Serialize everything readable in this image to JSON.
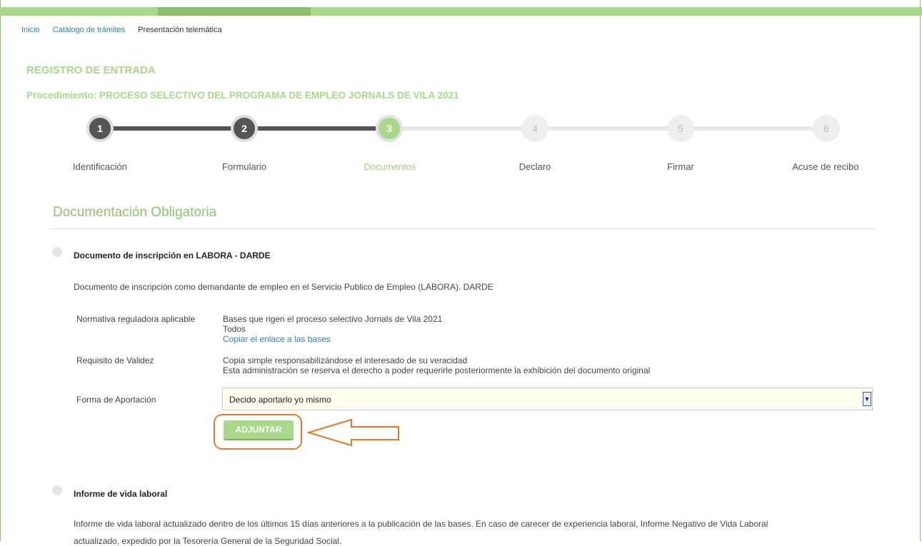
{
  "breadcrumb": {
    "inicio": "Inicio",
    "catalogo": "Catálogo de trámites",
    "current": "Presentación telemática"
  },
  "header": {
    "registro": "REGISTRO DE ENTRADA",
    "procedimiento": "Procedimiento: PROCESO SELECTIVO DEL PROGRAMA DE EMPLEO JORNALS DE VILA 2021"
  },
  "steps": [
    {
      "num": "1",
      "label": "Identificación",
      "state": "done"
    },
    {
      "num": "2",
      "label": "Formulario",
      "state": "done"
    },
    {
      "num": "3",
      "label": "Documentos",
      "state": "active"
    },
    {
      "num": "4",
      "label": "Declaro",
      "state": "todo"
    },
    {
      "num": "5",
      "label": "Firmar",
      "state": "todo"
    },
    {
      "num": "6",
      "label": "Acuse de recibo",
      "state": "todo"
    }
  ],
  "section": {
    "title": "Documentación Obligatoria"
  },
  "doc1": {
    "title": "Documento de inscripción en LABORA - DARDE",
    "description": "Documento de inscripción como demandante de empleo en el Servicio Publico de Empleo (LABORA). DARDE",
    "normativa_label": "Normativa reguladora aplicable",
    "normativa_line1": "Bases que rigen el proceso selectivo Jornals de Vila 2021",
    "normativa_line2": "Todos",
    "normativa_link": "Copiar el enlace a las bases",
    "requisito_label": "Requisito de Validez",
    "requisito_line1": "Copia simple responsabilizándose el interesado de su veracidad",
    "requisito_line2": "Esta administración se reserva el derecho a poder requerirle posteriormente la exhibición del documento original",
    "forma_label": "Forma de Aportación",
    "forma_value": "Decido aportarlo yo mismo",
    "attach_label": "ADJUNTAR"
  },
  "doc2": {
    "title": "Informe de vida laboral",
    "description": "Informe de vida laboral actualizado dentro de los últimos 15 días anteriores a la publicación de las bases. En caso de carecer de experiencia laboral, Informe Negativo de Vida Laboral",
    "description_cont": "actualizado, expedido por la Tesorería General de la Seguridad Social."
  },
  "colors": {
    "accent": "#a8d98a",
    "link": "#2a7fba",
    "highlight": "#e07b2a"
  }
}
